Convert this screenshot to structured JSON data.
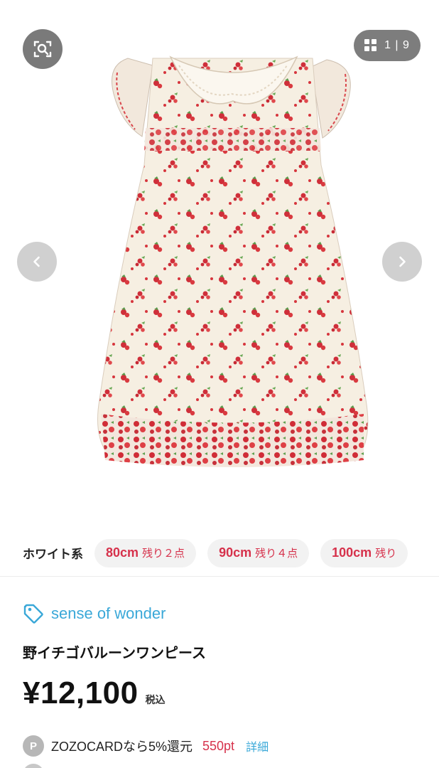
{
  "gallery": {
    "current": "1",
    "separator": "|",
    "total": "9"
  },
  "variants": {
    "color_label": "ホワイト系",
    "sizes": [
      {
        "size": "80cm",
        "stock": "残り２点"
      },
      {
        "size": "90cm",
        "stock": "残り４点"
      },
      {
        "size": "100cm",
        "stock": "残り"
      }
    ]
  },
  "product": {
    "brand": "sense of wonder",
    "title": "野イチゴバルーンワンピース",
    "price": "¥12,100",
    "tax_label": "税込",
    "points_badge": "P",
    "points_text": "ZOZOCARDなら5%還元",
    "points_value": "550pt",
    "details_link": "詳細"
  },
  "colors": {
    "accent_blue": "#3aa8d8",
    "accent_red": "#d6314b"
  },
  "icons": {
    "lens": "image-search-icon",
    "grid": "grid-icon",
    "prev": "chevron-left-icon",
    "next": "chevron-right-icon",
    "tag": "tag-icon"
  }
}
